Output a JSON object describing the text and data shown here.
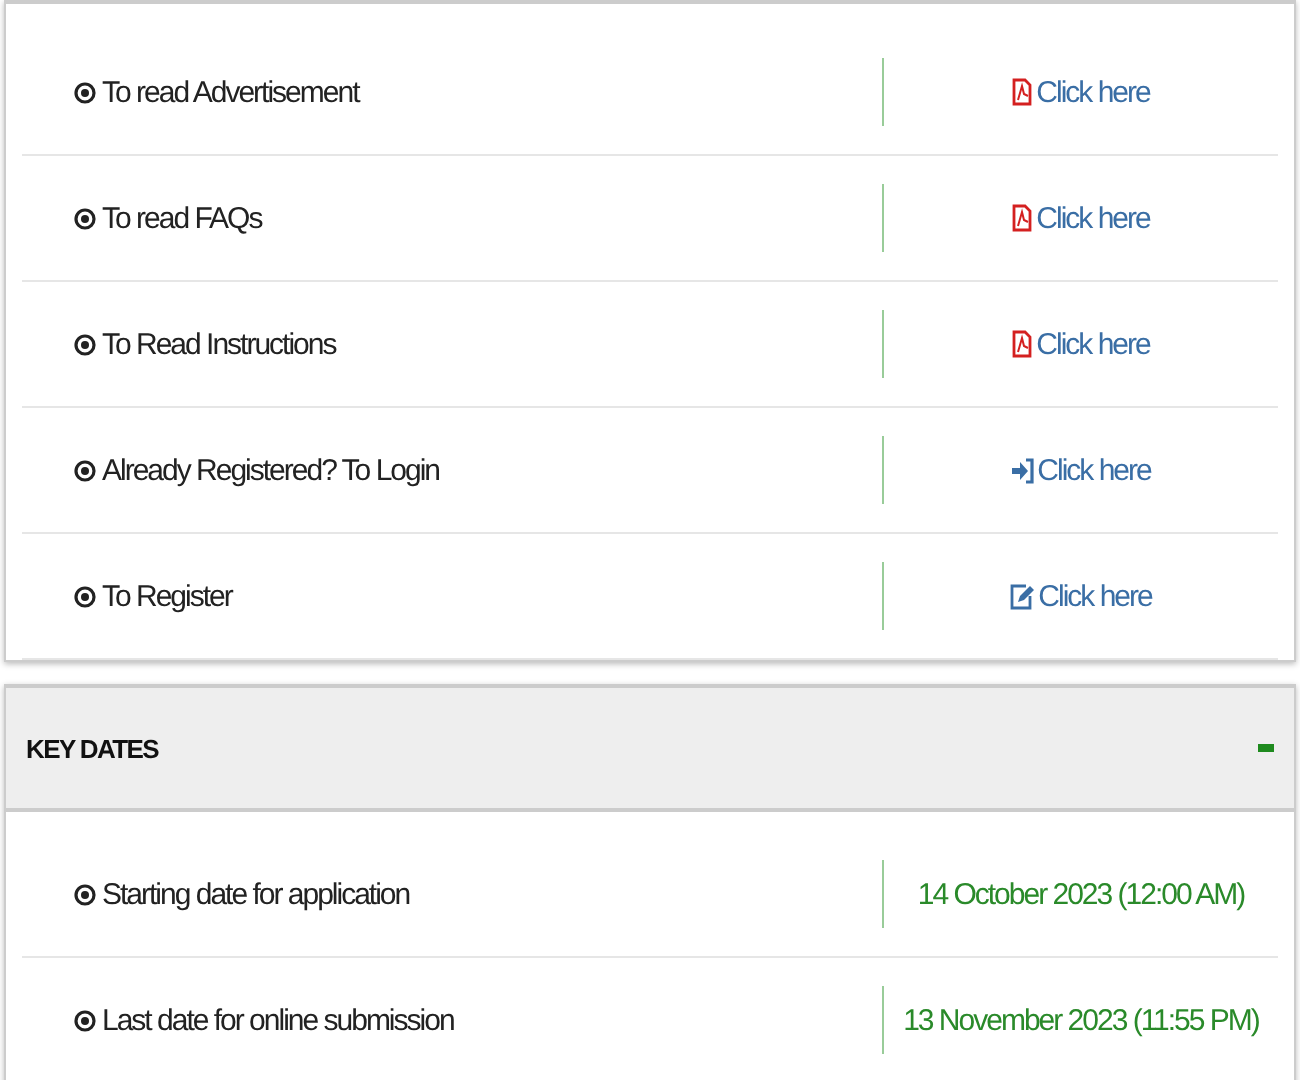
{
  "links": [
    {
      "label": "To read Advertisement",
      "action": "Click here",
      "kind": "pdf"
    },
    {
      "label": "To read FAQs",
      "action": "Click here",
      "kind": "pdf"
    },
    {
      "label": "To Read Instructions",
      "action": "Click here",
      "kind": "pdf"
    },
    {
      "label": "Already Registered? To Login",
      "action": "Click here",
      "kind": "login"
    },
    {
      "label": "To Register",
      "action": "Click here",
      "kind": "register"
    }
  ],
  "key_dates": {
    "title": "KEY DATES",
    "expanded": true,
    "rows": [
      {
        "label": "Starting date for application",
        "value": "14 October 2023 (12:00 AM)"
      },
      {
        "label": "Last date for online submission",
        "value": "13 November 2023 (11:55 PM)"
      }
    ]
  }
}
